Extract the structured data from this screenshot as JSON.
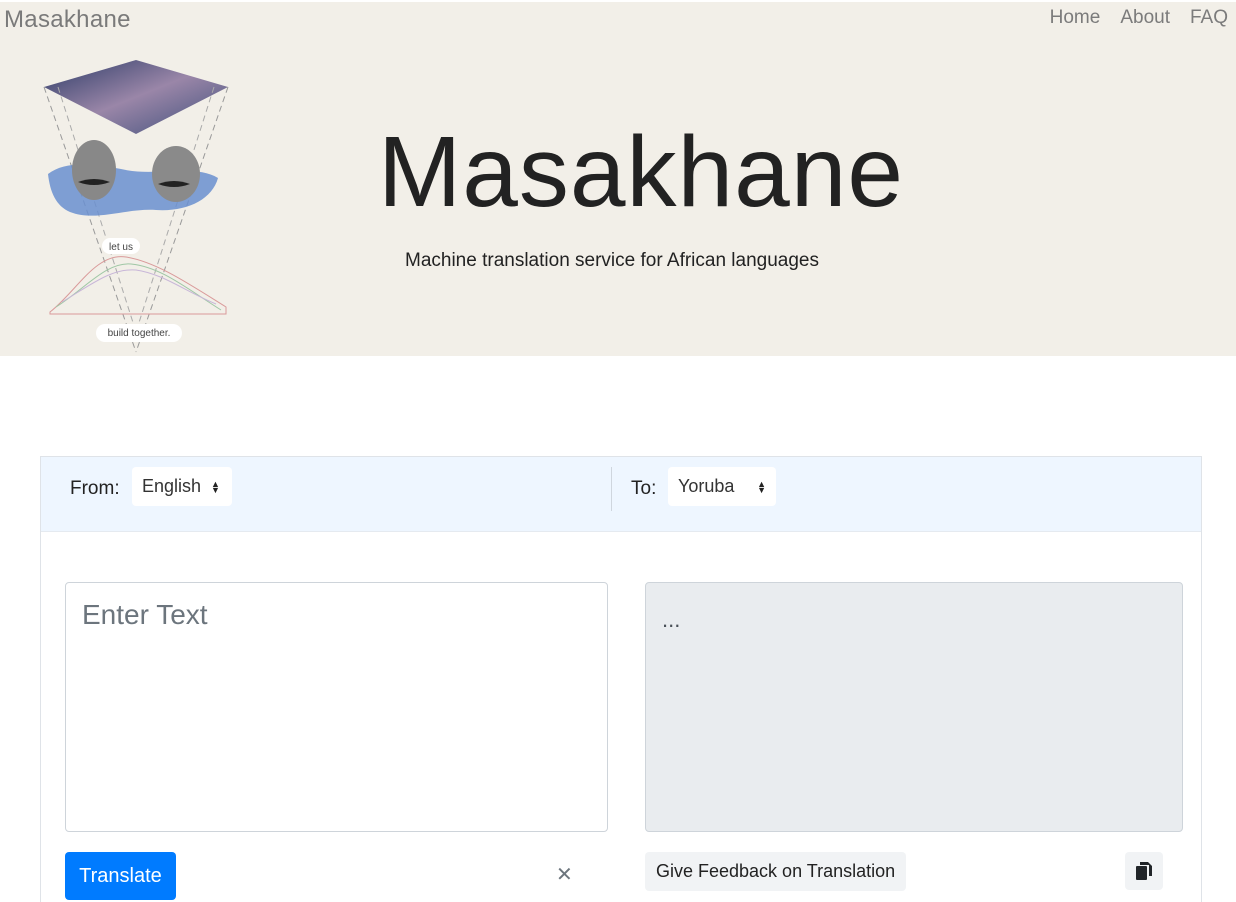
{
  "nav": {
    "brand": "Masakhane",
    "links": [
      "Home",
      "About",
      "FAQ"
    ]
  },
  "hero": {
    "title": "Masakhane",
    "subtitle": "Machine translation service for African languages",
    "logo_text_1": "let us",
    "logo_text_2": "build together."
  },
  "translator": {
    "from_label": "From:",
    "from_value": "English",
    "to_label": "To:",
    "to_value": "Yoruba",
    "input_placeholder": "Enter Text",
    "output_text": "...",
    "translate_label": "Translate",
    "clear_icon": "close-icon",
    "feedback_label": "Give Feedback on Translation",
    "copy_icon": "copy-icon"
  },
  "colors": {
    "hero_bg": "#f2efe8",
    "header_bg": "#eef6ff",
    "primary": "#007bff"
  }
}
